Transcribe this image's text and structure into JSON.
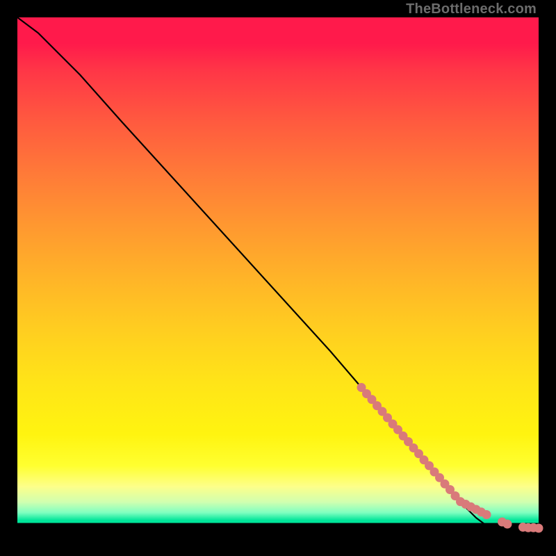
{
  "watermark": "TheBottleneck.com",
  "chart_data": {
    "type": "line",
    "title": "",
    "xlabel": "",
    "ylabel": "",
    "xlim": [
      0,
      100
    ],
    "ylim": [
      0,
      100
    ],
    "series": [
      {
        "name": "curve",
        "type": "line",
        "color": "#000000",
        "x": [
          0,
          4,
          8,
          12,
          20,
          30,
          40,
          50,
          60,
          66,
          72,
          78,
          84,
          88,
          90,
          93,
          96,
          100
        ],
        "y": [
          100,
          97,
          93,
          89,
          80,
          69,
          58,
          47,
          36,
          29,
          22,
          15,
          8,
          4,
          2.5,
          2.2,
          2.1,
          2.0
        ]
      },
      {
        "name": "dots",
        "type": "scatter",
        "color": "#d97a7a",
        "x": [
          66,
          67,
          68,
          69,
          70,
          71,
          72,
          73,
          74,
          75,
          76,
          77,
          78,
          79,
          80,
          81,
          82,
          83,
          84,
          85,
          86,
          87,
          88,
          89,
          90,
          93,
          94,
          97,
          98,
          99,
          100
        ],
        "y": [
          29.0,
          27.8,
          26.7,
          25.5,
          24.4,
          23.2,
          22.0,
          20.9,
          19.7,
          18.6,
          17.4,
          16.3,
          15.1,
          14.0,
          12.8,
          11.7,
          10.5,
          9.4,
          8.2,
          7.1,
          6.6,
          6.1,
          5.6,
          5.1,
          4.6,
          3.2,
          2.8,
          2.2,
          2.1,
          2.1,
          2.0
        ]
      }
    ]
  }
}
